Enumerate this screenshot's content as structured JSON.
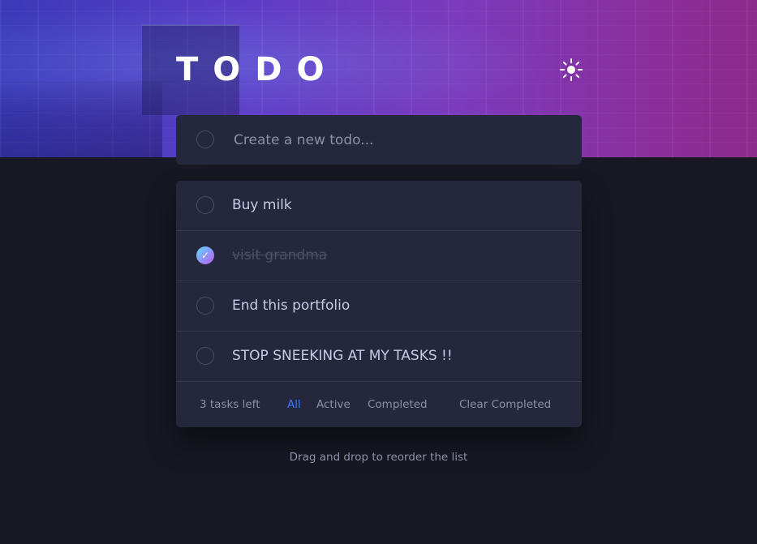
{
  "app": {
    "title": "TODO"
  },
  "header": {
    "theme_toggle_icon": "sun-icon"
  },
  "new_todo": {
    "placeholder": "Create a new todo..."
  },
  "todos": [
    {
      "text": "Buy milk",
      "completed": false
    },
    {
      "text": "visit grandma",
      "completed": true
    },
    {
      "text": "End this portfolio",
      "completed": false
    },
    {
      "text": "STOP SNEEKING AT MY TASKS !!",
      "completed": false
    }
  ],
  "footer": {
    "items_left": "3 tasks left",
    "filters": [
      "All",
      "Active",
      "Completed"
    ],
    "active_filter": "All",
    "clear_completed": "Clear Completed"
  },
  "hint": "Drag and drop to reorder the list",
  "colors": {
    "background": "#181824",
    "card": "#25273c",
    "accent": "#3a7cfd",
    "check_gradient_start": "#57ddff",
    "check_gradient_end": "#c058f3"
  },
  "icons": {
    "check": "check-icon",
    "theme": "sun-icon"
  }
}
